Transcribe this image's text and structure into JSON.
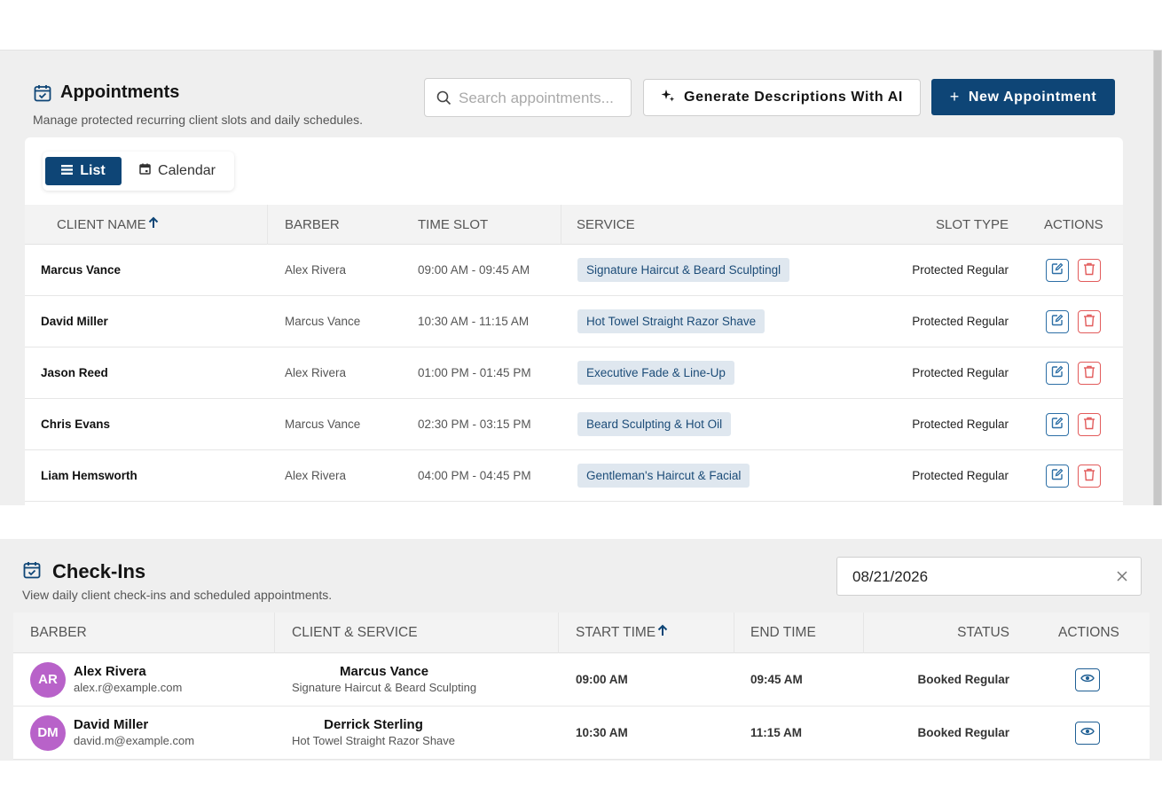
{
  "appointments": {
    "title": "Appointments",
    "subtitle": "Manage protected recurring client slots and daily schedules.",
    "search_placeholder": "Search appointments...",
    "generate_label": "Generate Descriptions With AI",
    "new_label": "New Appointment",
    "view_toggle": {
      "list_label": "List",
      "calendar_label": "Calendar",
      "active": "List"
    },
    "columns": [
      "CLIENT NAME",
      "BARBER",
      "TIME SLOT",
      "SERVICE",
      "SLOT TYPE",
      "ACTIONS"
    ],
    "sort_column": "CLIENT NAME",
    "rows": [
      {
        "client": "Marcus Vance",
        "barber": "Alex Rivera",
        "time": "09:00 AM - 09:45 AM",
        "service": "Signature Haircut & Beard Sculptingl",
        "slot_type": "Protected Regular"
      },
      {
        "client": "David Miller",
        "barber": "Marcus Vance",
        "time": "10:30 AM - 11:15 AM",
        "service": "Hot Towel Straight Razor Shave",
        "slot_type": "Protected Regular"
      },
      {
        "client": "Jason Reed",
        "barber": "Alex Rivera",
        "time": "01:00 PM - 01:45 PM",
        "service": "Executive Fade & Line-Up",
        "slot_type": "Protected Regular"
      },
      {
        "client": "Chris Evans",
        "barber": "Marcus Vance",
        "time": "02:30 PM - 03:15 PM",
        "service": "Beard Sculpting & Hot Oil",
        "slot_type": "Protected Regular"
      },
      {
        "client": "Liam Hemsworth",
        "barber": "Alex Rivera",
        "time": "04:00 PM - 04:45 PM",
        "service": "Gentleman's Haircut & Facial",
        "slot_type": "Protected Regular"
      }
    ]
  },
  "checkins": {
    "title": "Check-Ins",
    "subtitle": "View daily client check-ins and scheduled appointments.",
    "date_value": "08/21/2026",
    "columns": [
      "BARBER",
      "CLIENT & SERVICE",
      "START TIME",
      "END TIME",
      "STATUS",
      "ACTIONS"
    ],
    "sort_column": "START TIME",
    "rows": [
      {
        "initials": "AR",
        "barber": "Alex Rivera",
        "email": "alex.r@example.com",
        "client": "Marcus Vance",
        "service": "Signature Haircut & Beard Sculpting",
        "start": "09:00 AM",
        "end": "09:45 AM",
        "status": "Booked Regular"
      },
      {
        "initials": "DM",
        "barber": "David Miller",
        "email": "david.m@example.com",
        "client": "Derrick Sterling",
        "service": "Hot Towel Straight Razor Shave",
        "start": "10:30 AM",
        "end": "11:15 AM",
        "status": "Booked Regular"
      }
    ]
  },
  "colors": {
    "primary": "#0e4576",
    "chip_bg": "#dfe7ef",
    "chip_text": "#1c4c78",
    "delete": "#e25b5b",
    "avatar": "#b862c9",
    "panel_bg": "#efefef"
  },
  "icons": [
    "calendar-check-icon",
    "search-icon",
    "sparkle-icon",
    "plus-icon",
    "list-icon",
    "calendar-icon",
    "sort-up-arrow-icon",
    "edit-icon",
    "trash-icon",
    "close-icon",
    "eye-icon"
  ]
}
